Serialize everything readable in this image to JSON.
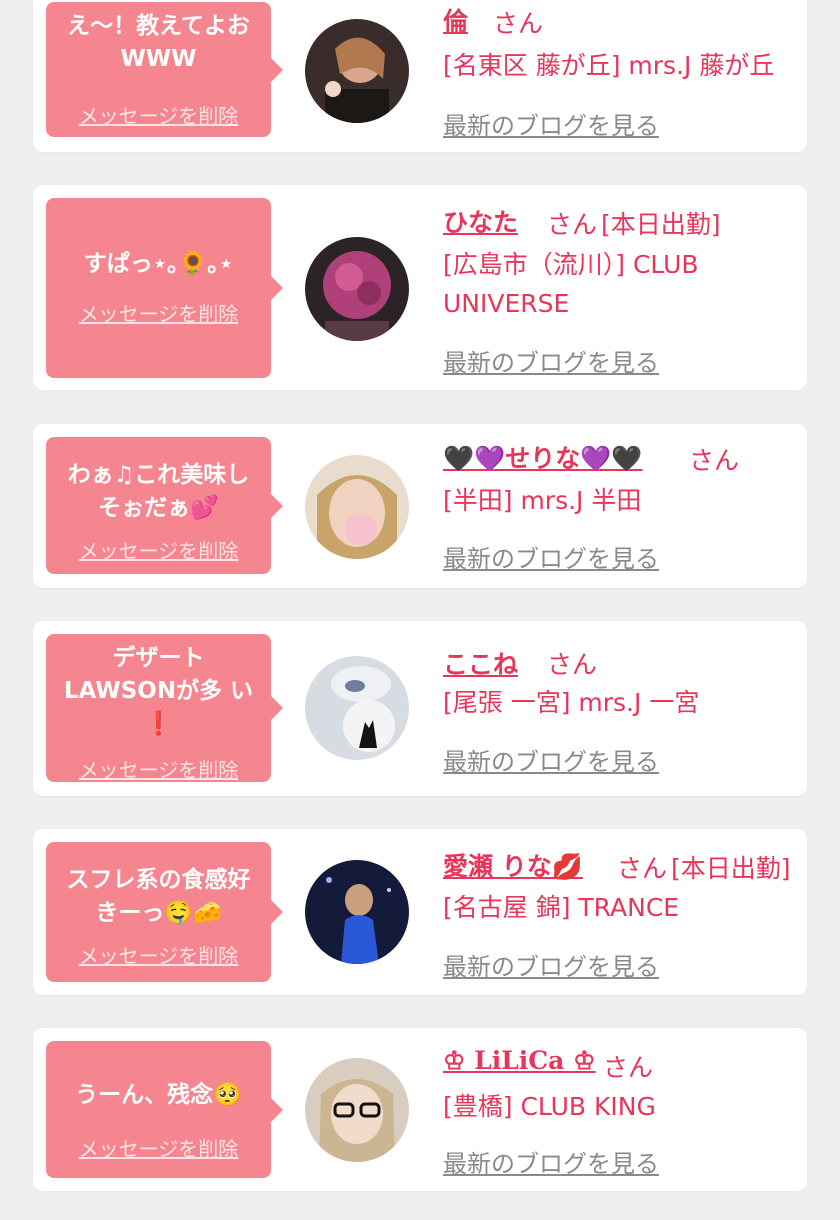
{
  "delete_label": "メッセージを削除",
  "blog_label": "最新のブログを見る",
  "san_label": "さん",
  "colors": {
    "accent": "#e8355a",
    "bubble": "#f5868f",
    "background": "#efefef"
  },
  "cards": [
    {
      "message": "え〜！教えてよお WWW",
      "name": "倫",
      "status": "",
      "shop": "[名東区 藤が丘] mrs.J 藤が丘"
    },
    {
      "message": "すぱっ⋆｡🌻｡⋆",
      "name": "ひなた",
      "status": "[本日出勤]",
      "shop": "[広島市（流川）] CLUB UNIVERSE"
    },
    {
      "message": "わぁ♫これ美味し そぉだぁ💕",
      "name": "🖤💜せりな💜🖤",
      "status": "",
      "shop": "[半田] mrs.J 半田"
    },
    {
      "message": "デザート LAWSONが多 い❗️",
      "name": "ここね",
      "status": "",
      "shop": "[尾張 一宮] mrs.J 一宮"
    },
    {
      "message": "スフレ系の食感好 きーっ🤤🧀",
      "name": "愛瀬 りな💋",
      "status": "[本日出勤]",
      "shop": "[名古屋 錦] TRANCE"
    },
    {
      "message": "うーん、残念🥺",
      "name": "♔ LiLiCa ♔",
      "status": "",
      "shop": "[豊橋] CLUB KING"
    }
  ]
}
